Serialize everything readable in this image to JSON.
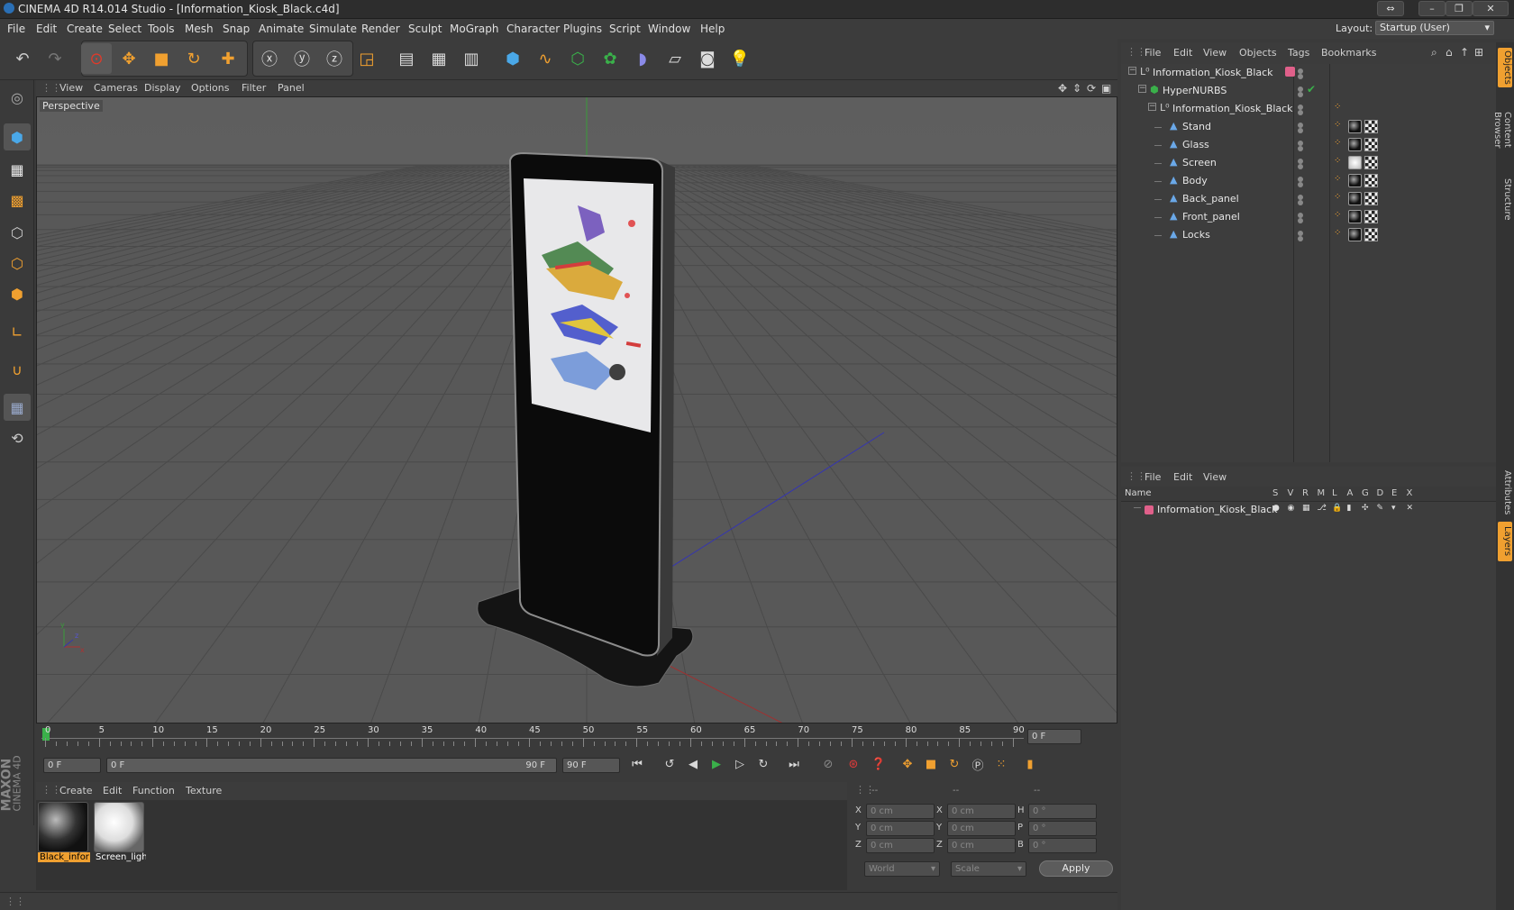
{
  "window": {
    "title": "CINEMA 4D R14.014 Studio - [Information_Kiosk_Black.c4d]",
    "layout_label": "Layout:",
    "layout_value": "Startup (User)"
  },
  "menu": [
    "File",
    "Edit",
    "Create",
    "Select",
    "Tools",
    "Mesh",
    "Snap",
    "Animate",
    "Simulate",
    "Render",
    "Sculpt",
    "MoGraph",
    "Character",
    "Plugins",
    "Script",
    "Window",
    "Help"
  ],
  "viewport": {
    "menu": [
      "View",
      "Cameras",
      "Display",
      "Options",
      "Filter",
      "Panel"
    ],
    "label": "Perspective"
  },
  "timeline": {
    "ticks": [
      "0",
      "5",
      "10",
      "15",
      "20",
      "25",
      "30",
      "35",
      "40",
      "45",
      "50",
      "55",
      "60",
      "65",
      "70",
      "75",
      "80",
      "85",
      "90"
    ],
    "current_frame": "0 F",
    "start_field": "0 F",
    "range_start": "0 F",
    "range_end": "90 F",
    "end_field": "90 F"
  },
  "materials": {
    "menu": [
      "Create",
      "Edit",
      "Function",
      "Texture"
    ],
    "items": [
      {
        "name": "Black_infor",
        "selected": true
      },
      {
        "name": "Screen_ligh",
        "selected": false
      }
    ]
  },
  "coords": {
    "headers": [
      "--",
      "--",
      "--"
    ],
    "rows": [
      {
        "a": "X",
        "av": "0 cm",
        "b": "X",
        "bv": "0 cm",
        "c": "H",
        "cv": "0 °"
      },
      {
        "a": "Y",
        "av": "0 cm",
        "b": "Y",
        "bv": "0 cm",
        "c": "P",
        "cv": "0 °"
      },
      {
        "a": "Z",
        "av": "0 cm",
        "b": "Z",
        "bv": "0 cm",
        "c": "B",
        "cv": "0 °"
      }
    ],
    "space": "World",
    "mode": "Scale",
    "apply": "Apply"
  },
  "objects": {
    "menu": [
      "File",
      "Edit",
      "View",
      "Objects",
      "Tags",
      "Bookmarks"
    ],
    "tree": [
      {
        "name": "Information_Kiosk_Black",
        "indent": 0
      },
      {
        "name": "HyperNURBS",
        "indent": 1
      },
      {
        "name": "Information_Kiosk_Black",
        "indent": 2
      },
      {
        "name": "Stand",
        "indent": 3
      },
      {
        "name": "Glass",
        "indent": 3
      },
      {
        "name": "Screen",
        "indent": 3
      },
      {
        "name": "Body",
        "indent": 3
      },
      {
        "name": "Back_panel",
        "indent": 3
      },
      {
        "name": "Front_panel",
        "indent": 3
      },
      {
        "name": "Locks",
        "indent": 3
      }
    ]
  },
  "layers": {
    "menu": [
      "File",
      "Edit",
      "View"
    ],
    "name_header": "Name",
    "flags": [
      "S",
      "V",
      "R",
      "M",
      "L",
      "A",
      "G",
      "D",
      "E",
      "X"
    ],
    "rows": [
      {
        "name": "Information_Kiosk_Black"
      }
    ]
  },
  "side_tabs": [
    "Objects",
    "Content Browser",
    "Structure",
    "Attributes",
    "Layers"
  ],
  "brand": {
    "line1": "MAXON",
    "line2": "CINEMA 4D"
  },
  "colors": {
    "accent": "#f0a030",
    "layer_pink": "#e0608a",
    "grid_green": "#3a9b3a"
  }
}
